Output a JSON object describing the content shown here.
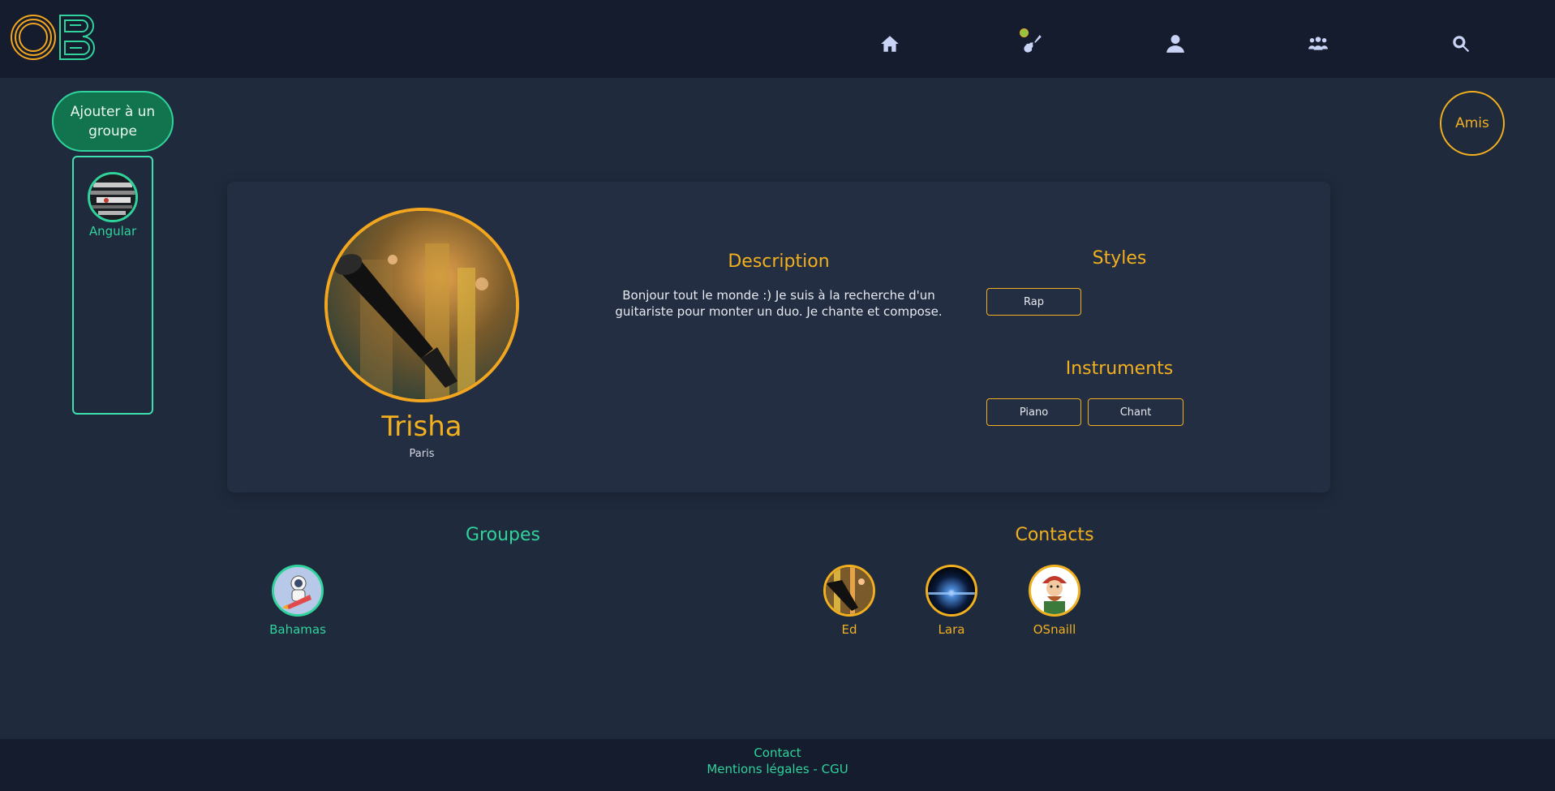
{
  "brand": {
    "logo_text": "OB"
  },
  "nav": {
    "items": [
      {
        "icon": "home-icon"
      },
      {
        "icon": "guitar-icon"
      },
      {
        "icon": "user-icon"
      },
      {
        "icon": "users-icon"
      },
      {
        "icon": "search-icon"
      }
    ]
  },
  "sidebar": {
    "add_group_label": "Ajouter à un groupe",
    "groups": [
      {
        "label": "Angular"
      }
    ]
  },
  "friends_button": {
    "label": "Amis"
  },
  "profile": {
    "name": "Trisha",
    "city": "Paris",
    "description_title": "Description",
    "description": "Bonjour tout le monde :) Je suis à la recherche d'un guitariste pour monter un duo. Je chante et compose.",
    "styles_title": "Styles",
    "styles": [
      "Rap"
    ],
    "instruments_title": "Instruments",
    "instruments": [
      "Piano",
      "Chant"
    ]
  },
  "groups_section": {
    "title": "Groupes",
    "items": [
      {
        "label": "Bahamas"
      }
    ]
  },
  "contacts_section": {
    "title": "Contacts",
    "items": [
      {
        "label": "Ed"
      },
      {
        "label": "Lara"
      },
      {
        "label": "OSnaill"
      }
    ]
  },
  "footer": {
    "contact_label": "Contact",
    "legal_label": "Mentions légales - CGU"
  },
  "colors": {
    "accent_orange": "#f2b01e",
    "accent_green": "#2fd39b",
    "background": "#1f2a3d",
    "topbar": "#141c2e"
  }
}
